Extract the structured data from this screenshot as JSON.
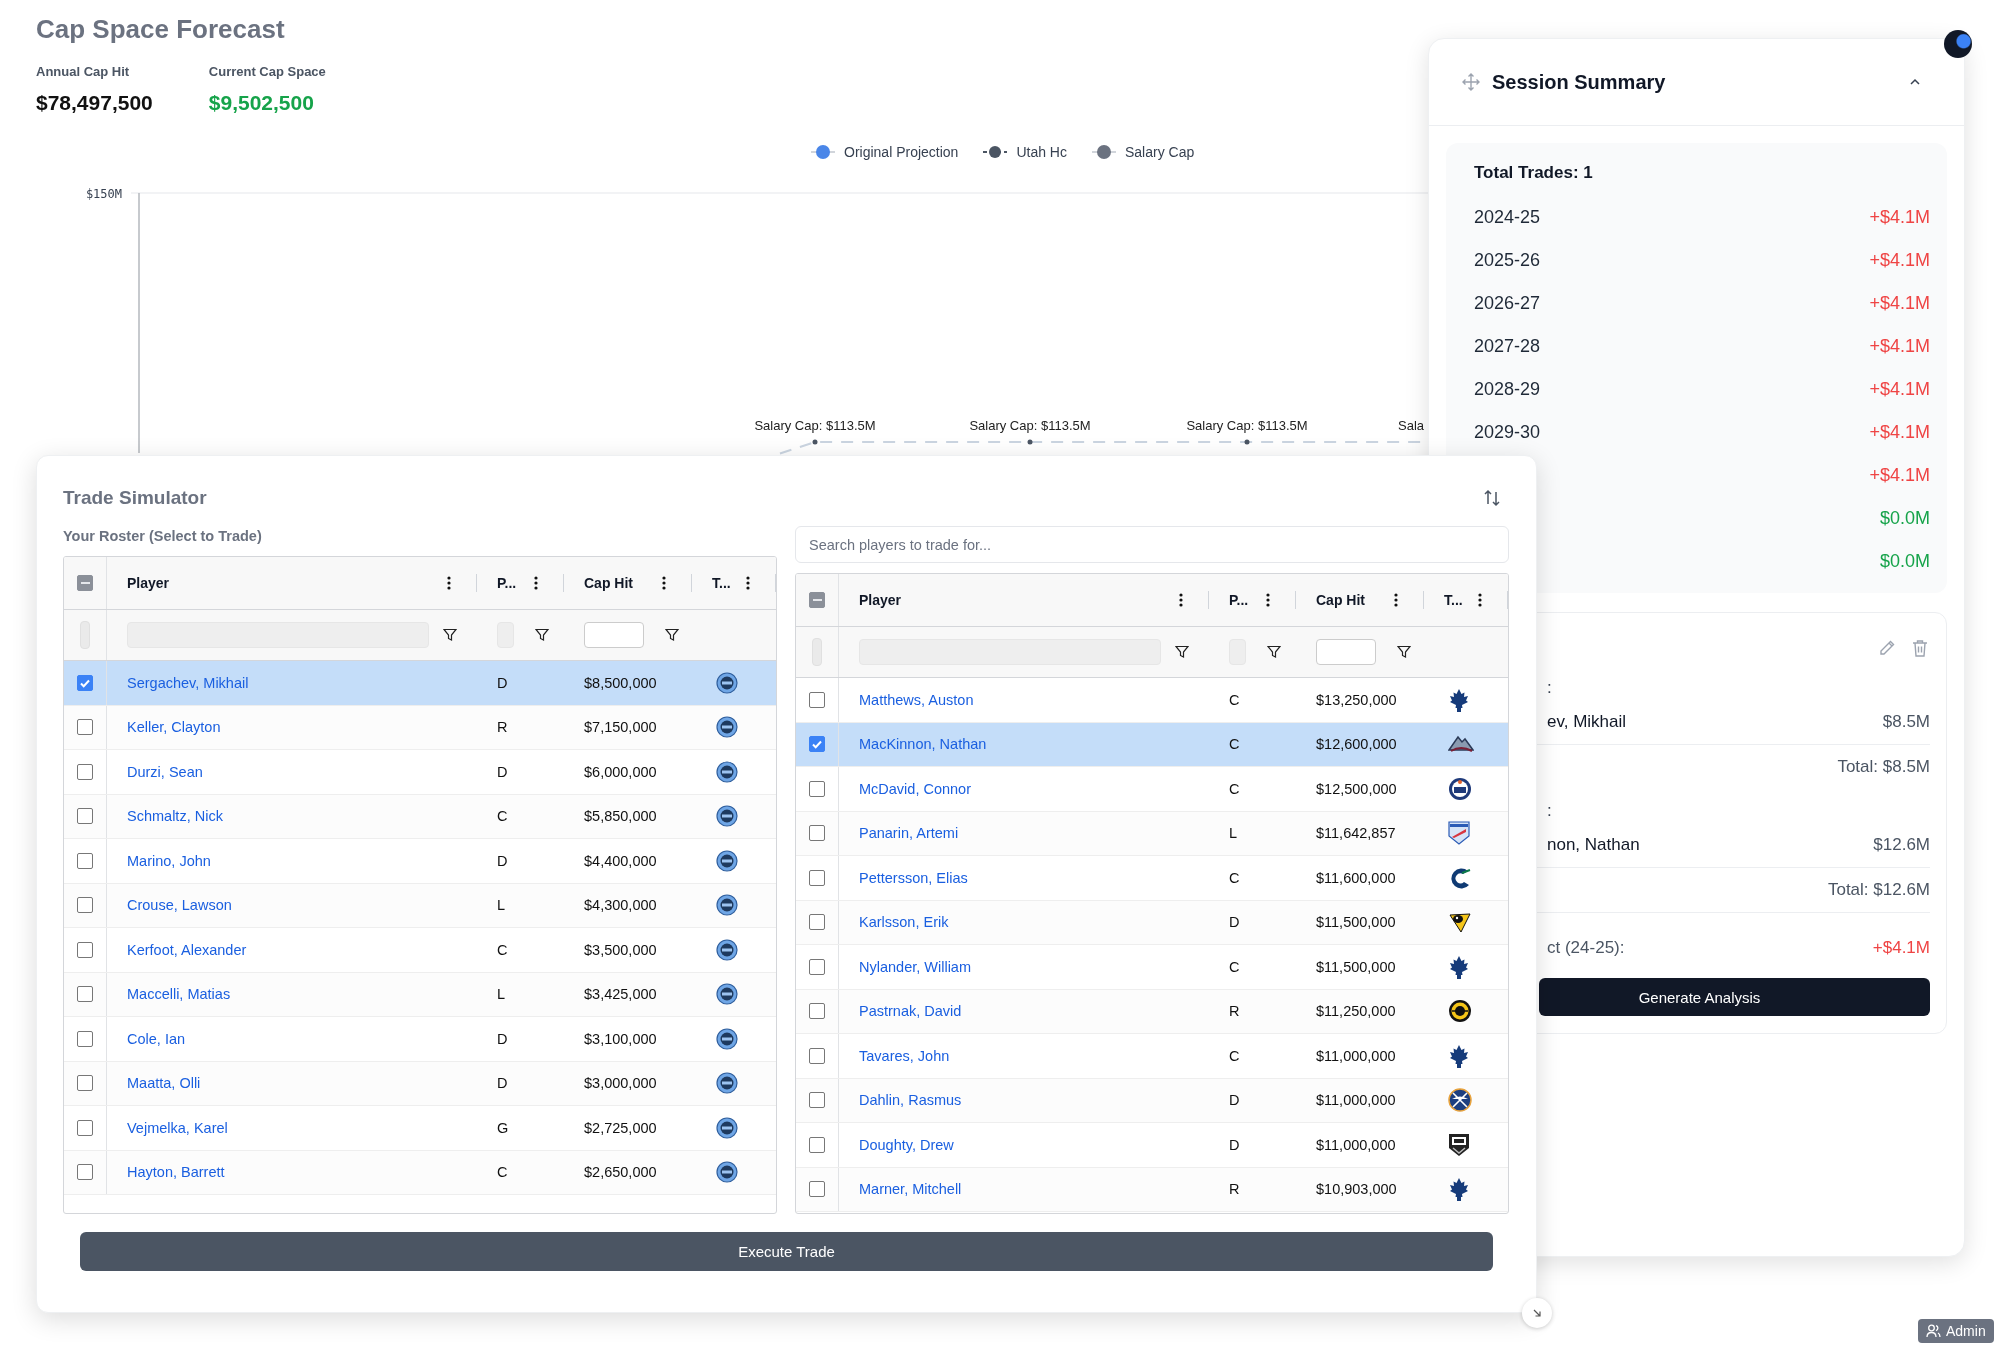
{
  "page": {
    "title": "Cap Space Forecast"
  },
  "stats": [
    {
      "label": "Annual Cap Hit",
      "value": "$78,497,500",
      "kind": "neutral"
    },
    {
      "label": "Current Cap Space",
      "value": "$9,502,500",
      "kind": "positive"
    }
  ],
  "chart": {
    "legend": [
      {
        "label": "Original Projection",
        "color": "#4a86e8",
        "kind": "dot"
      },
      {
        "label": "Utah Hc",
        "color": "#4b5563",
        "kind": "dash-dot"
      },
      {
        "label": "Salary Cap",
        "color": "#6b7280",
        "kind": "dot"
      }
    ],
    "y_tick": "$150M",
    "point_labels": [
      "Salary Cap: $113.5M",
      "Salary Cap: $113.5M",
      "Salary Cap: $113.5M",
      "Sala"
    ]
  },
  "session_summary": {
    "title": "Session Summary",
    "expanded": true,
    "total_trades": "Total Trades: 1",
    "seasons": [
      {
        "season": "2024-25",
        "change": "+$4.1M",
        "kind": "increase"
      },
      {
        "season": "2025-26",
        "change": "+$4.1M",
        "kind": "increase"
      },
      {
        "season": "2026-27",
        "change": "+$4.1M",
        "kind": "increase"
      },
      {
        "season": "2027-28",
        "change": "+$4.1M",
        "kind": "increase"
      },
      {
        "season": "2028-29",
        "change": "+$4.1M",
        "kind": "increase"
      },
      {
        "season": "2029-30",
        "change": "+$4.1M",
        "kind": "increase"
      },
      {
        "change": "+$4.1M",
        "kind": "increase"
      },
      {
        "change": "$0.0M",
        "kind": "zero"
      },
      {
        "change": "$0.0M",
        "kind": "zero"
      }
    ],
    "trade": {
      "outgoing_label": ":",
      "outgoing": [
        {
          "player": "ev, Mikhail",
          "cap_hit": "$8.5M"
        }
      ],
      "outgoing_total": "Total: $8.5M",
      "incoming_label": ":",
      "incoming": [
        {
          "player": "non, Nathan",
          "cap_hit": "$12.6M"
        }
      ],
      "incoming_total": "Total: $12.6M",
      "impact_label": "ct (24-25):",
      "impact": "+$4.1M",
      "action": "Generate Analysis"
    }
  },
  "trade_simulator": {
    "title": "Trade Simulator",
    "roster": {
      "label": "Your Roster (Select to Trade)",
      "table": {
        "select_all_indeterminate": true,
        "columns": [
          "Player",
          "P...",
          "Cap Hit",
          "T..."
        ],
        "rows": [
          {
            "player": "Sergachev, Mikhail",
            "position": "D",
            "cap_hit": "$8,500,000",
            "selected": true,
            "kind": "badge"
          },
          {
            "player": "Keller, Clayton",
            "position": "R",
            "cap_hit": "$7,150,000",
            "selected": false,
            "kind": "badge"
          },
          {
            "player": "Durzi, Sean",
            "position": "D",
            "cap_hit": "$6,000,000",
            "selected": false,
            "kind": "badge"
          },
          {
            "player": "Schmaltz, Nick",
            "position": "C",
            "cap_hit": "$5,850,000",
            "selected": false,
            "kind": "badge"
          },
          {
            "player": "Marino, John",
            "position": "D",
            "cap_hit": "$4,400,000",
            "selected": false,
            "kind": "badge"
          },
          {
            "player": "Crouse, Lawson",
            "position": "L",
            "cap_hit": "$4,300,000",
            "selected": false,
            "kind": "badge"
          },
          {
            "player": "Kerfoot, Alexander",
            "position": "C",
            "cap_hit": "$3,500,000",
            "selected": false,
            "kind": "badge"
          },
          {
            "player": "Maccelli, Matias",
            "position": "L",
            "cap_hit": "$3,425,000",
            "selected": false,
            "kind": "badge"
          },
          {
            "player": "Cole, Ian",
            "position": "D",
            "cap_hit": "$3,100,000",
            "selected": false,
            "kind": "badge"
          },
          {
            "player": "Maatta, Olli",
            "position": "D",
            "cap_hit": "$3,000,000",
            "selected": false,
            "kind": "badge"
          },
          {
            "player": "Vejmelka, Karel",
            "position": "G",
            "cap_hit": "$2,725,000",
            "selected": false,
            "kind": "badge"
          },
          {
            "player": "Hayton, Barrett",
            "position": "C",
            "cap_hit": "$2,650,000",
            "selected": false,
            "kind": "badge"
          }
        ]
      }
    },
    "market": {
      "search": {
        "placeholder": "Search players to trade for..."
      },
      "table": {
        "select_all_indeterminate": true,
        "columns": [
          "Player",
          "P...",
          "Cap Hit",
          "T..."
        ],
        "rows": [
          {
            "player": "Matthews, Auston",
            "position": "C",
            "cap_hit": "$13,250,000",
            "selected": false,
            "kind": "leaf"
          },
          {
            "player": "MacKinnon, Nathan",
            "position": "C",
            "cap_hit": "$12,600,000",
            "selected": true,
            "kind": "peak"
          },
          {
            "player": "McDavid, Connor",
            "position": "C",
            "cap_hit": "$12,500,000",
            "selected": false,
            "kind": "ring"
          },
          {
            "player": "Panarin, Artemi",
            "position": "L",
            "cap_hit": "$11,642,857",
            "selected": false,
            "kind": "flag"
          },
          {
            "player": "Pettersson, Elias",
            "position": "C",
            "cap_hit": "$11,600,000",
            "selected": false,
            "kind": "crescent"
          },
          {
            "player": "Karlsson, Erik",
            "position": "D",
            "cap_hit": "$11,500,000",
            "selected": false,
            "kind": "bird"
          },
          {
            "player": "Nylander, William",
            "position": "C",
            "cap_hit": "$11,500,000",
            "selected": false,
            "kind": "leaf"
          },
          {
            "player": "Pastrnak, David",
            "position": "R",
            "cap_hit": "$11,250,000",
            "selected": false,
            "kind": "striped"
          },
          {
            "player": "Tavares, John",
            "position": "C",
            "cap_hit": "$11,000,000",
            "selected": false,
            "kind": "leaf"
          },
          {
            "player": "Dahlin, Rasmus",
            "position": "D",
            "cap_hit": "$11,000,000",
            "selected": false,
            "kind": "crossed"
          },
          {
            "player": "Doughty, Drew",
            "position": "D",
            "cap_hit": "$11,000,000",
            "selected": false,
            "kind": "shield"
          },
          {
            "player": "Marner, Mitchell",
            "position": "R",
            "cap_hit": "$10,903,000",
            "selected": false,
            "kind": "leaf"
          }
        ]
      }
    },
    "execute": "Execute Trade"
  },
  "admin_badge": "Admin"
}
